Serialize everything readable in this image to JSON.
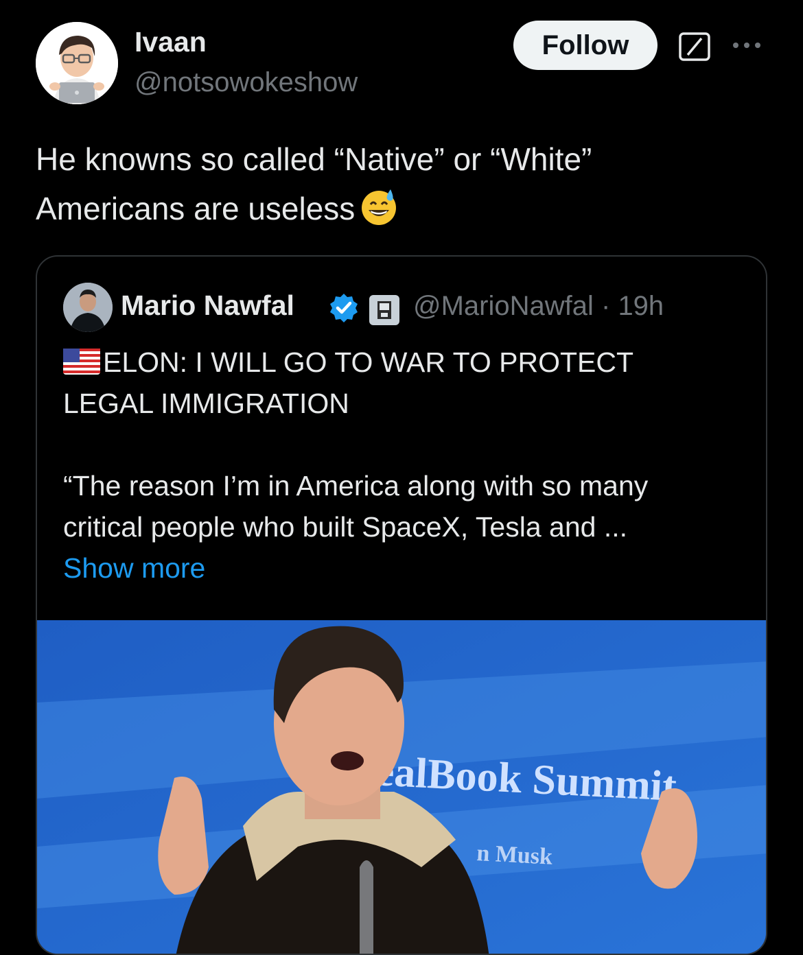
{
  "author": {
    "display_name": "Ivaan",
    "handle": "@notsowokeshow",
    "avatar_icon": "memoji-laptop-avatar"
  },
  "actions": {
    "follow_label": "Follow",
    "grok_icon": "grok-icon",
    "more_icon": "more-dots-icon"
  },
  "tweet": {
    "line1": "He knowns so called “Native” or “White”",
    "line2": "Americans are useless",
    "emoji": "grinning-face-with-sweat-emoji"
  },
  "quote": {
    "author_name": "Mario Nawfal",
    "verified_icon": "verified-badge-icon",
    "handle_time": "@MarioNawfal · 19h",
    "headline_line1": "ELON: I WILL GO TO WAR TO PROTECT",
    "headline_line2": "LEGAL IMMIGRATION",
    "body_line1": "“The reason I’m in America along with so many",
    "body_line2": "critical people who built SpaceX, Tesla and ...",
    "show_more": "Show more",
    "media_text_main": "ealBook Summit",
    "media_text_sub": "n Musk"
  },
  "colors": {
    "background": "#000000",
    "text": "#e7e9ea",
    "secondary": "#71767b",
    "link": "#1d9bf0",
    "verified": "#1d9bf0",
    "follow_bg": "#eff3f4",
    "border": "#2f3336"
  }
}
